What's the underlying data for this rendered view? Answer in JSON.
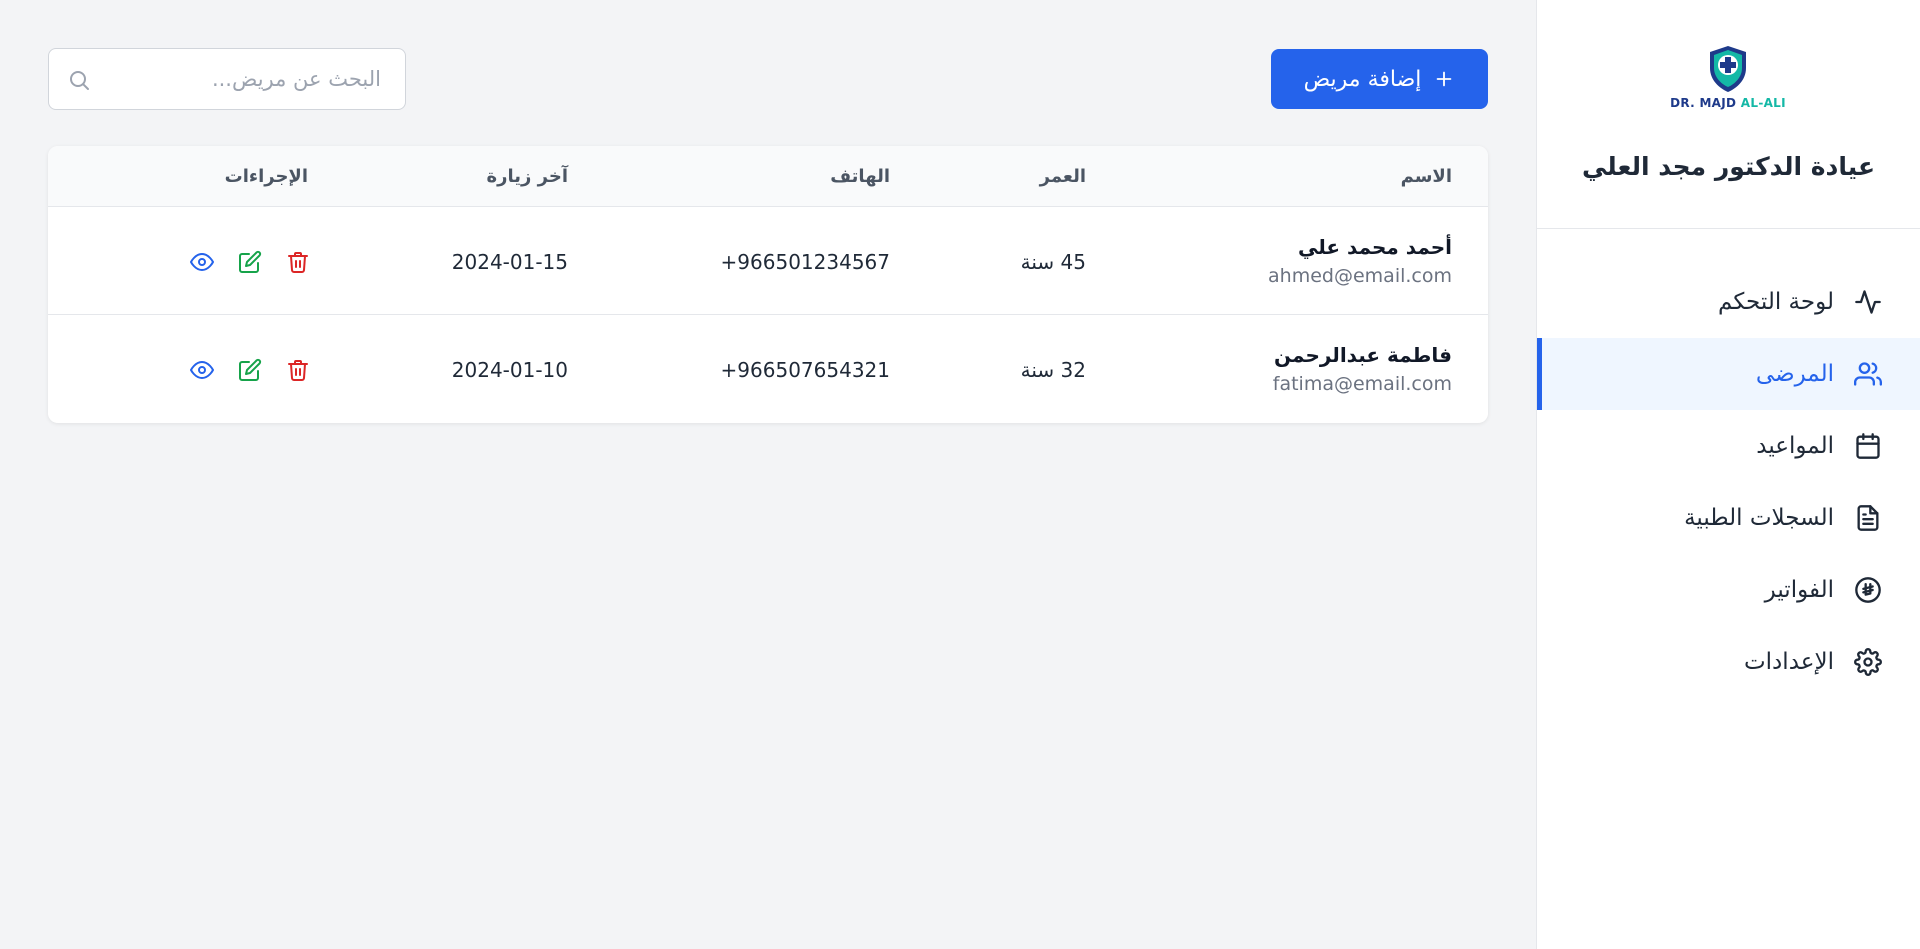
{
  "sidebar": {
    "logo": {
      "text_primary": "DR. MAJD ",
      "text_accent": "AL-ALI"
    },
    "clinic_name": "عيادة الدكتور مجد العلي",
    "items": [
      {
        "label": "لوحة التحكم",
        "icon": "activity-icon",
        "active": false
      },
      {
        "label": "المرضى",
        "icon": "users-icon",
        "active": true
      },
      {
        "label": "المواعيد",
        "icon": "calendar-icon",
        "active": false
      },
      {
        "label": "السجلات الطبية",
        "icon": "document-icon",
        "active": false
      },
      {
        "label": "الفواتير",
        "icon": "currency-icon",
        "active": false
      },
      {
        "label": "الإعدادات",
        "icon": "gear-icon",
        "active": false
      }
    ]
  },
  "toolbar": {
    "add_label": "إضافة مريض",
    "search_placeholder": "البحث عن مريض..."
  },
  "table": {
    "headers": {
      "name": "الاسم",
      "age": "العمر",
      "phone": "الهاتف",
      "last_visit": "آخر زيارة",
      "actions": "الإجراءات"
    },
    "rows": [
      {
        "name": "أحمد محمد علي",
        "email": "ahmed@email.com",
        "age": "45 سنة",
        "phone": "966501234567+",
        "last_visit": "2024-01-15"
      },
      {
        "name": "فاطمة عبدالرحمن",
        "email": "fatima@email.com",
        "age": "32 سنة",
        "phone": "966507654321+",
        "last_visit": "2024-01-10"
      }
    ]
  },
  "colors": {
    "primary": "#2563eb",
    "view": "#2563eb",
    "edit": "#16a34a",
    "delete": "#dc2626"
  }
}
